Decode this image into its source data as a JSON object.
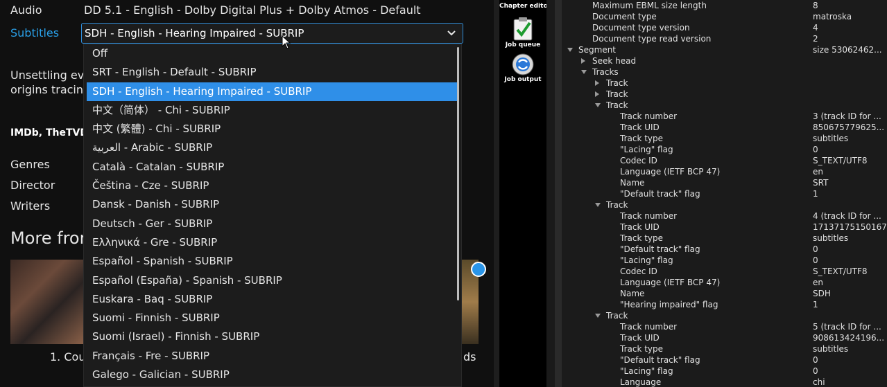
{
  "details": {
    "audio_label": "Audio",
    "audio_value": "DD 5.1 - English - Dolby Digital Plus + Dolby Atmos - Default",
    "subtitles_label": "Subtitles",
    "subtitles_selected": "SDH - English - Hearing Impaired - SUBRIP",
    "overview_line1": "Unsettling eve",
    "overview_line2": "origins tracing",
    "ratings_text": "IMDb, TheTVD",
    "genres_label": "Genres",
    "director_label": "Director",
    "writers_label": "Writers",
    "more_heading": "More from",
    "caption1": "1. Cou",
    "caption2": "ds"
  },
  "dropdown": {
    "selected_index": 2,
    "options": [
      "Off",
      "SRT - English - Default - SUBRIP",
      "SDH - English - Hearing Impaired - SUBRIP",
      "中文（简体） - Chi - SUBRIP",
      "中文 (繁體) - Chi - SUBRIP",
      "العربية - Arabic - SUBRIP",
      "Català - Catalan - SUBRIP",
      "Čeština - Cze - SUBRIP",
      "Dansk - Danish - SUBRIP",
      "Deutsch - Ger - SUBRIP",
      "Ελληνικά - Gre - SUBRIP",
      "Español - Spanish - SUBRIP",
      "Español (España) - Spanish - SUBRIP",
      "Euskara - Baq - SUBRIP",
      "Suomi - Finnish - SUBRIP",
      "Suomi (Israel) - Finnish - SUBRIP",
      "Français - Fre - SUBRIP",
      "Galego - Galician - SUBRIP"
    ]
  },
  "toolbar": {
    "chapter_editor": "Chapter editor",
    "job_queue": "Job queue",
    "job_output": "Job output"
  },
  "tree": [
    {
      "label": "Maximum EBML size length",
      "value": "8",
      "level": 2,
      "arrow": ""
    },
    {
      "label": "Document type",
      "value": "matroska",
      "level": 2,
      "arrow": ""
    },
    {
      "label": "Document type version",
      "value": "4",
      "level": 2,
      "arrow": ""
    },
    {
      "label": "Document type read version",
      "value": "2",
      "level": 2,
      "arrow": ""
    },
    {
      "label": "Segment",
      "value": "size 53062462...",
      "level": 1,
      "arrow": "down"
    },
    {
      "label": "Seek head",
      "value": "",
      "level": 2,
      "arrow": "right"
    },
    {
      "label": "Tracks",
      "value": "",
      "level": 2,
      "arrow": "down"
    },
    {
      "label": "Track",
      "value": "",
      "level": 3,
      "arrow": "right"
    },
    {
      "label": "Track",
      "value": "",
      "level": 3,
      "arrow": "right"
    },
    {
      "label": "Track",
      "value": "",
      "level": 3,
      "arrow": "down"
    },
    {
      "label": "Track number",
      "value": "3 (track ID for ...",
      "level": 4,
      "arrow": ""
    },
    {
      "label": "Track UID",
      "value": "850675779625...",
      "level": 4,
      "arrow": ""
    },
    {
      "label": "Track type",
      "value": "subtitles",
      "level": 4,
      "arrow": ""
    },
    {
      "label": "\"Lacing\" flag",
      "value": "0",
      "level": 4,
      "arrow": ""
    },
    {
      "label": "Codec ID",
      "value": "S_TEXT/UTF8",
      "level": 4,
      "arrow": ""
    },
    {
      "label": "Language (IETF BCP 47)",
      "value": "en",
      "level": 4,
      "arrow": ""
    },
    {
      "label": "Name",
      "value": "SRT",
      "level": 4,
      "arrow": ""
    },
    {
      "label": "\"Default track\" flag",
      "value": "1",
      "level": 4,
      "arrow": ""
    },
    {
      "label": "Track",
      "value": "",
      "level": 3,
      "arrow": "down"
    },
    {
      "label": "Track number",
      "value": "4 (track ID for ...",
      "level": 4,
      "arrow": ""
    },
    {
      "label": "Track UID",
      "value": "17137175150167...",
      "level": 4,
      "arrow": ""
    },
    {
      "label": "Track type",
      "value": "subtitles",
      "level": 4,
      "arrow": ""
    },
    {
      "label": "\"Default track\" flag",
      "value": "0",
      "level": 4,
      "arrow": ""
    },
    {
      "label": "\"Lacing\" flag",
      "value": "0",
      "level": 4,
      "arrow": ""
    },
    {
      "label": "Codec ID",
      "value": "S_TEXT/UTF8",
      "level": 4,
      "arrow": ""
    },
    {
      "label": "Language (IETF BCP 47)",
      "value": "en",
      "level": 4,
      "arrow": ""
    },
    {
      "label": "Name",
      "value": "SDH",
      "level": 4,
      "arrow": ""
    },
    {
      "label": "\"Hearing impaired\" flag",
      "value": "1",
      "level": 4,
      "arrow": ""
    },
    {
      "label": "Track",
      "value": "",
      "level": 3,
      "arrow": "down"
    },
    {
      "label": "Track number",
      "value": "5 (track ID for ...",
      "level": 4,
      "arrow": ""
    },
    {
      "label": "Track UID",
      "value": "908613424196...",
      "level": 4,
      "arrow": ""
    },
    {
      "label": "Track type",
      "value": "subtitles",
      "level": 4,
      "arrow": ""
    },
    {
      "label": "\"Default track\" flag",
      "value": "0",
      "level": 4,
      "arrow": ""
    },
    {
      "label": "\"Lacing\" flag",
      "value": "0",
      "level": 4,
      "arrow": ""
    },
    {
      "label": "Language",
      "value": "chi",
      "level": 4,
      "arrow": ""
    }
  ],
  "colors": {
    "accent": "#2f8fe8",
    "panel_bg": "#1b1b1b",
    "page_bg": "#101010"
  }
}
